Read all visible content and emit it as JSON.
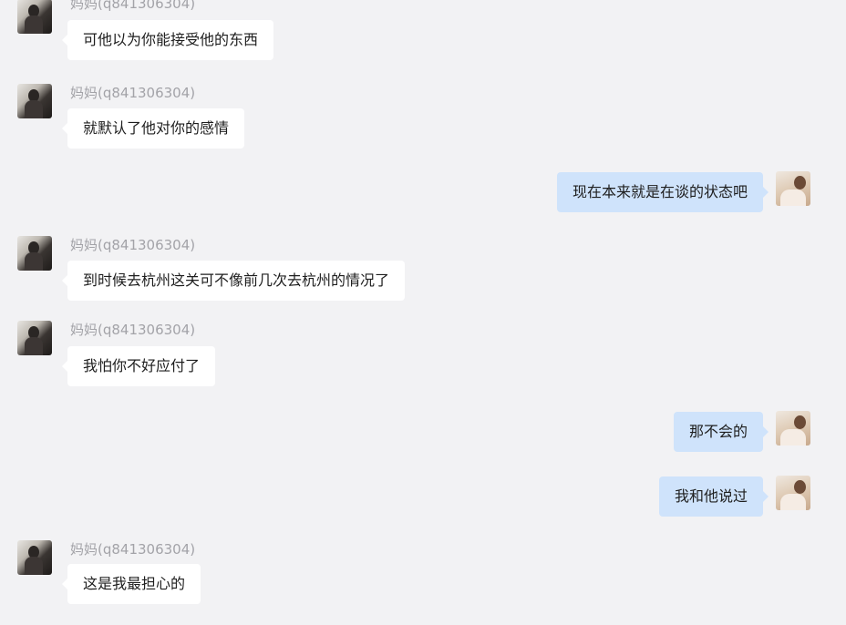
{
  "chat": {
    "messages": [
      {
        "sender": "other",
        "name": "妈妈(q841306304)",
        "text": "可他以为你能接受他的东西"
      },
      {
        "sender": "other",
        "name": "妈妈(q841306304)",
        "text": "就默认了他对你的感情"
      },
      {
        "sender": "self",
        "text": "现在本来就是在谈的状态吧"
      },
      {
        "sender": "other",
        "name": "妈妈(q841306304)",
        "text": "到时候去杭州这关可不像前几次去杭州的情况了"
      },
      {
        "sender": "other",
        "name": "妈妈(q841306304)",
        "text": "我怕你不好应付了"
      },
      {
        "sender": "self",
        "text": "那不会的"
      },
      {
        "sender": "self",
        "text": "我和他说过"
      },
      {
        "sender": "other",
        "name": "妈妈(q841306304)",
        "text": "这是我最担心的"
      }
    ]
  },
  "colors": {
    "background": "#f2f2f4",
    "incoming_bubble": "#ffffff",
    "outgoing_bubble": "#cfe3fb",
    "name_text": "#a3a3a8"
  }
}
